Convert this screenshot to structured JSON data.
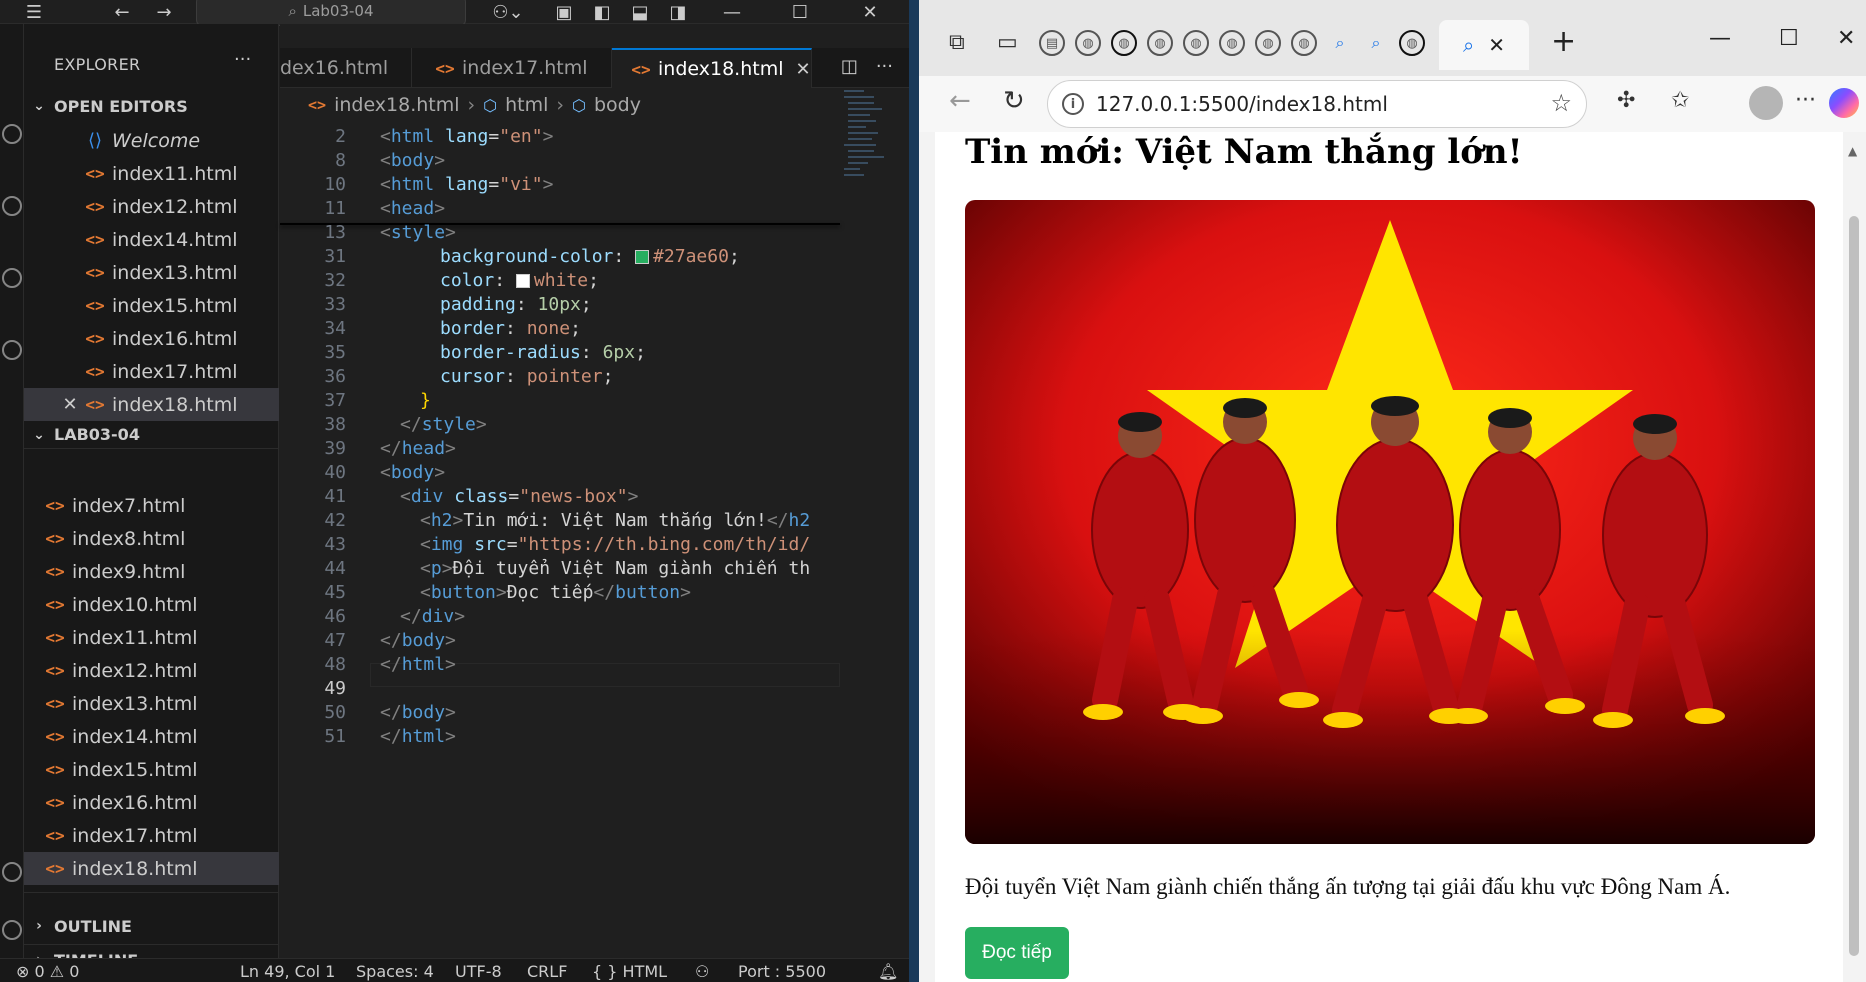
{
  "vscode": {
    "search_text": "Lab03-04",
    "explorer_title": "EXPLORER",
    "open_editors_label": "OPEN EDITORS",
    "open_editors": [
      "Welcome",
      "index11.html",
      "index12.html",
      "index14.html",
      "index13.html",
      "index15.html",
      "index16.html",
      "index17.html",
      "index18.html"
    ],
    "folder_label": "LAB03-04",
    "folder_files": [
      "index7.html",
      "index8.html",
      "index9.html",
      "index10.html",
      "index11.html",
      "index12.html",
      "index13.html",
      "index14.html",
      "index15.html",
      "index16.html",
      "index17.html",
      "index18.html"
    ],
    "outline_label": "OUTLINE",
    "timeline_label": "TIMELINE",
    "tabs": [
      "dex16.html",
      "index17.html",
      "index18.html"
    ],
    "breadcrumb": [
      "index18.html",
      "html",
      "body"
    ],
    "code_lines": [
      {
        "n": "2",
        "text": "<html lang=\"en\">"
      },
      {
        "n": "8",
        "text": "<body>"
      },
      {
        "n": "10",
        "text": "<html lang=\"vi\">"
      },
      {
        "n": "11",
        "text": "<head>"
      },
      {
        "n": "13",
        "text": "  <style>"
      },
      {
        "n": "31",
        "text": "background-color: #27ae60;"
      },
      {
        "n": "32",
        "text": "color: white;"
      },
      {
        "n": "33",
        "text": "padding: 10px;"
      },
      {
        "n": "34",
        "text": "border: none;"
      },
      {
        "n": "35",
        "text": "border-radius: 6px;"
      },
      {
        "n": "36",
        "text": "cursor: pointer;"
      },
      {
        "n": "37",
        "text": "}"
      },
      {
        "n": "38",
        "text": "</style>"
      },
      {
        "n": "39",
        "text": "</head>"
      },
      {
        "n": "40",
        "text": "<body>"
      },
      {
        "n": "41",
        "text": "<div class=\"news-box\">"
      },
      {
        "n": "42",
        "text": "<h2>Tin mới: Việt Nam thắng lớn!</h2"
      },
      {
        "n": "43",
        "text": "<img src=\"https://th.bing.com/th/id/"
      },
      {
        "n": "44",
        "text": "<p>Đội tuyển Việt Nam giành chiến th"
      },
      {
        "n": "45",
        "text": "<button>Đọc tiếp</button>"
      },
      {
        "n": "46",
        "text": "</div>"
      },
      {
        "n": "47",
        "text": "</body>"
      },
      {
        "n": "48",
        "text": "</html>"
      },
      {
        "n": "49",
        "text": ""
      },
      {
        "n": "50",
        "text": "</body>"
      },
      {
        "n": "51",
        "text": "</html>"
      }
    ],
    "status": {
      "problems": "⊗ 0 ⚠ 0",
      "position": "Ln 49, Col 1",
      "spaces": "Spaces: 4",
      "encoding": "UTF-8",
      "eol": "CRLF",
      "language": "{ } HTML",
      "port": "Port : 5500"
    }
  },
  "browser": {
    "url": "127.0.0.1:5500/index18.html",
    "page": {
      "title": "Tin mới: Việt Nam thắng lớn!",
      "paragraph": "Đội tuyển Việt Nam giành chiến thắng ấn tượng tại giải đấu khu vực Đông Nam Á.",
      "button_label": "Đọc tiếp",
      "button_color": "#27ae60"
    }
  },
  "colors": {
    "accent": "#0078d4",
    "flag_red": "#da251d",
    "flag_star": "#ffff00"
  }
}
